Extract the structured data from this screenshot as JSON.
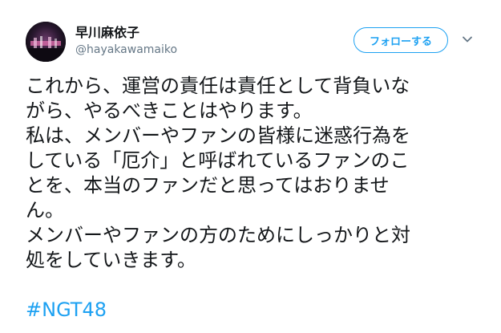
{
  "user": {
    "display_name": "早川麻依子",
    "handle": "@hayakawamaiko",
    "avatar": "avatar-photo"
  },
  "header": {
    "follow_label": "フォローする",
    "menu_icon": "chevron-down-icon"
  },
  "tweet": {
    "lines": [
      "これから、運営の責任は責任として背負いな",
      "がら、やるべきことはやります。",
      "私は、メンバーやファンの皆様に迷惑行為を",
      "している「厄介」と呼ばれているファンのこ",
      "とを、本当のファンだと思ってはおりませ",
      "ん。",
      "メンバーやファンの方のためにしっかりと対",
      "処をしていきます。"
    ],
    "hashtag": "#NGT48"
  },
  "colors": {
    "accent": "#1da1f2",
    "text": "#14171a",
    "secondary": "#657786"
  }
}
